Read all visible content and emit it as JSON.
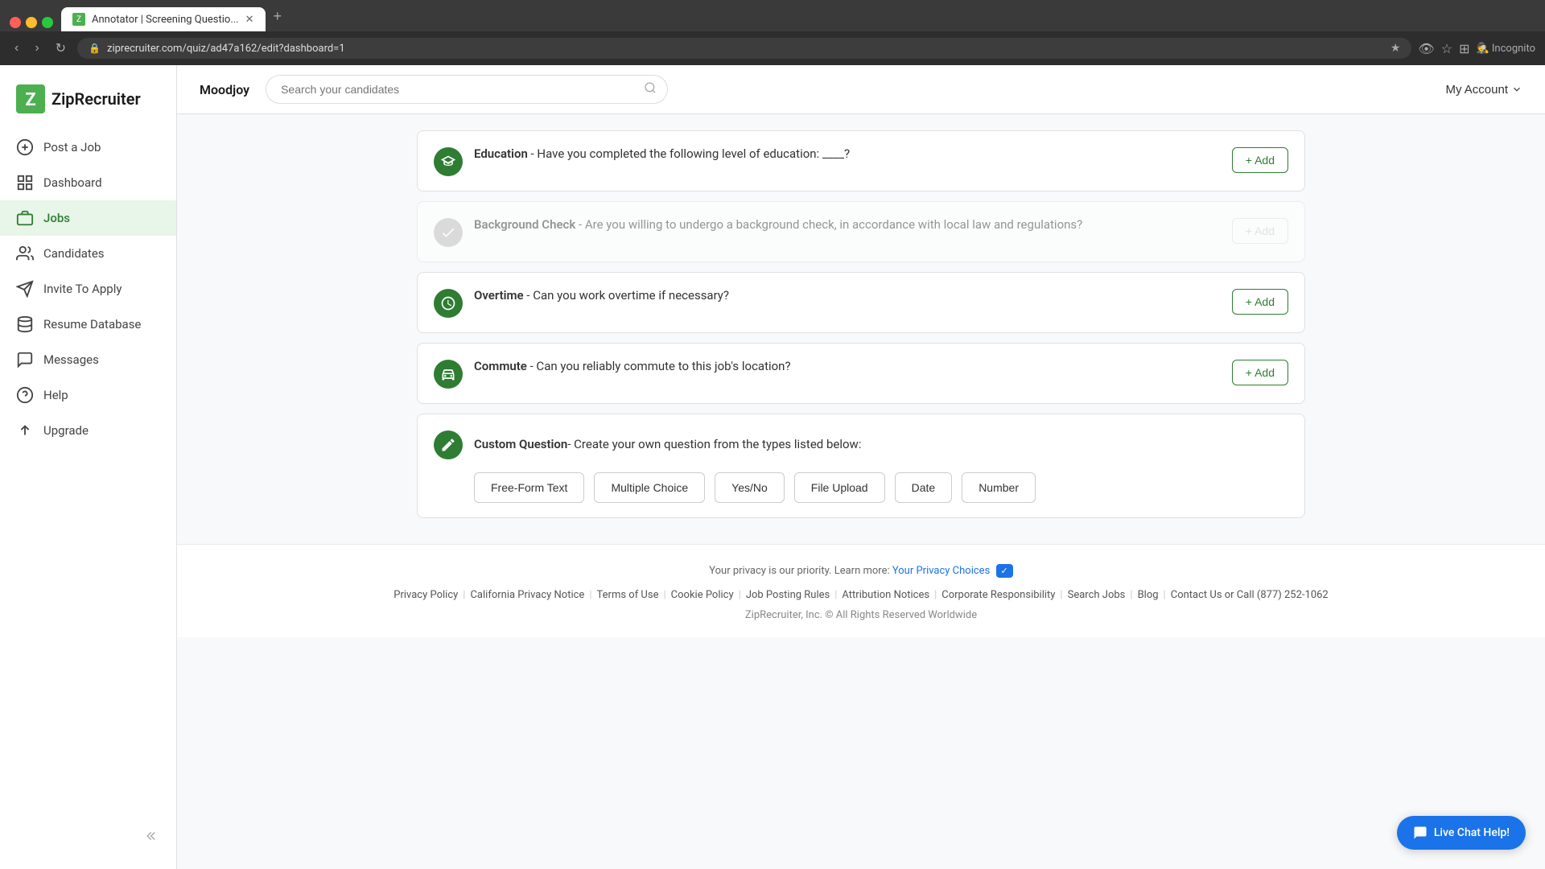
{
  "browser": {
    "url": "ziprecruiter.com/quiz/ad47a162/edit?dashboard=1",
    "tab_title": "Annotator | Screening Questio...",
    "tab_new_label": "+"
  },
  "header": {
    "company_name": "Moodjoy",
    "search_placeholder": "Search your candidates",
    "my_account_label": "My Account"
  },
  "sidebar": {
    "logo_text": "ZipRecruiter",
    "items": [
      {
        "id": "post-job",
        "label": "Post a Job",
        "icon": "plus"
      },
      {
        "id": "dashboard",
        "label": "Dashboard",
        "icon": "grid"
      },
      {
        "id": "jobs",
        "label": "Jobs",
        "icon": "briefcase",
        "active": true
      },
      {
        "id": "candidates",
        "label": "Candidates",
        "icon": "people"
      },
      {
        "id": "invite-to-apply",
        "label": "Invite To Apply",
        "icon": "send"
      },
      {
        "id": "resume-database",
        "label": "Resume Database",
        "icon": "database"
      },
      {
        "id": "messages",
        "label": "Messages",
        "icon": "message"
      },
      {
        "id": "help",
        "label": "Help",
        "icon": "question"
      },
      {
        "id": "upgrade",
        "label": "Upgrade",
        "icon": "arrow-up"
      }
    ]
  },
  "questions": [
    {
      "id": "education",
      "title": "Education",
      "description": "- Have you completed the following level of education: ____?",
      "icon_type": "green",
      "icon": "graduation",
      "add_label": "+ Add",
      "add_active": true,
      "disabled": false
    },
    {
      "id": "background-check",
      "title": "Background Check",
      "description": "- Are you willing to undergo a background check, in accordance with local law and regulations?",
      "icon_type": "gray",
      "icon": "check",
      "add_label": "+ Add",
      "add_active": false,
      "disabled": true
    },
    {
      "id": "overtime",
      "title": "Overtime",
      "description": "- Can you work overtime if necessary?",
      "icon_type": "green",
      "icon": "clock",
      "add_label": "+ Add",
      "add_active": true,
      "disabled": false
    },
    {
      "id": "commute",
      "title": "Commute",
      "description": "- Can you reliably commute to this job's location?",
      "icon_type": "green",
      "icon": "car",
      "add_label": "+ Add",
      "add_active": true,
      "disabled": false
    }
  ],
  "custom_question": {
    "title": "Custom Question",
    "description": "- Create your own question from the types listed below:",
    "types": [
      "Free-Form Text",
      "Multiple Choice",
      "Yes/No",
      "File Upload",
      "Date",
      "Number"
    ]
  },
  "footer": {
    "privacy_text": "Your privacy is our priority. Learn more:",
    "privacy_choices_label": "Your Privacy Choices",
    "links": [
      "Privacy Policy",
      "California Privacy Notice",
      "Terms of Use",
      "Cookie Policy",
      "Job Posting Rules",
      "Attribution Notices",
      "Corporate Responsibility",
      "Search Jobs",
      "Blog",
      "Contact Us or Call (877) 252-1062"
    ],
    "copyright": "ZipRecruiter, Inc. © All Rights Reserved Worldwide"
  },
  "live_chat": {
    "label": "Live Chat Help!"
  }
}
